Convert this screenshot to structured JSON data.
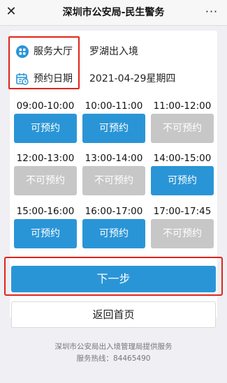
{
  "header": {
    "title": "深圳市公安局-民生警务",
    "close_glyph": "✕",
    "more_glyph": "···"
  },
  "info": {
    "hall_label": "服务大厅",
    "hall_value": "罗湖出入境",
    "date_label": "预约日期",
    "date_value": "2021-04-29星期四",
    "hall_icon": "grid-icon",
    "date_icon": "calendar-icon",
    "accent": "#2a95d6"
  },
  "slots": [
    {
      "time": "09:00-10:00",
      "status": "可预约",
      "available": true
    },
    {
      "time": "10:00-11:00",
      "status": "可预约",
      "available": true
    },
    {
      "time": "11:00-12:00",
      "status": "不可预约",
      "available": false
    },
    {
      "time": "12:00-13:00",
      "status": "不可预约",
      "available": false
    },
    {
      "time": "13:00-14:00",
      "status": "不可预约",
      "available": false
    },
    {
      "time": "14:00-15:00",
      "status": "可预约",
      "available": true
    },
    {
      "time": "15:00-16:00",
      "status": "可预约",
      "available": true
    },
    {
      "time": "16:00-17:00",
      "status": "可预约",
      "available": true
    },
    {
      "time": "17:00-17:45",
      "status": "不可预约",
      "available": false
    }
  ],
  "actions": {
    "next_label": "下一步",
    "back_label": "返回首页"
  },
  "footer": {
    "provider": "深圳市公安局出入境管理局提供服务",
    "hotline": "服务热线：84465490"
  },
  "colors": {
    "available": "#2a95d6",
    "unavailable": "#c7c7c7",
    "highlight": "#e2231a"
  }
}
